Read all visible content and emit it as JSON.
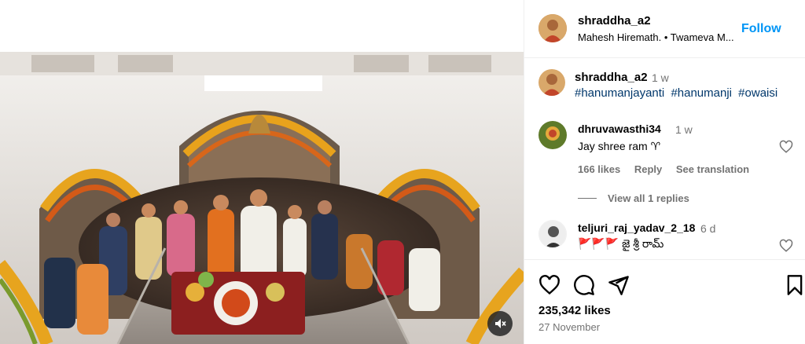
{
  "post_owner": {
    "username": "shraddha_a2",
    "audio_line": "Mahesh Hiremath. • Twameva M...",
    "follow_label": "Follow"
  },
  "caption": {
    "username": "shraddha_a2",
    "time": "1 w",
    "hashtags": [
      "#hanumanjayanti",
      "#hanumanji",
      "#owaisi"
    ]
  },
  "comments": [
    {
      "username": "dhruvawasthi34",
      "time": "1 w",
      "text": "Jay shree ram ♈",
      "likes": "166 likes",
      "reply_label": "Reply",
      "translate_label": "See translation",
      "view_replies": "View all 1 replies"
    },
    {
      "username": "teljuri_raj_yadav_2_18",
      "time": "6 d",
      "text": "🚩🚩🚩 జై శ్రీ రామ్"
    }
  ],
  "footer": {
    "likes": "235,342 likes",
    "date": "27 November"
  },
  "icons": {
    "like": "heart-icon",
    "comment": "comment-icon",
    "share": "share-icon",
    "save": "bookmark-icon",
    "mute": "speaker-muted-icon"
  },
  "colors": {
    "accent": "#0095f6",
    "hashtag": "#00376b",
    "muted_text": "#737373",
    "divider": "#efefef"
  }
}
